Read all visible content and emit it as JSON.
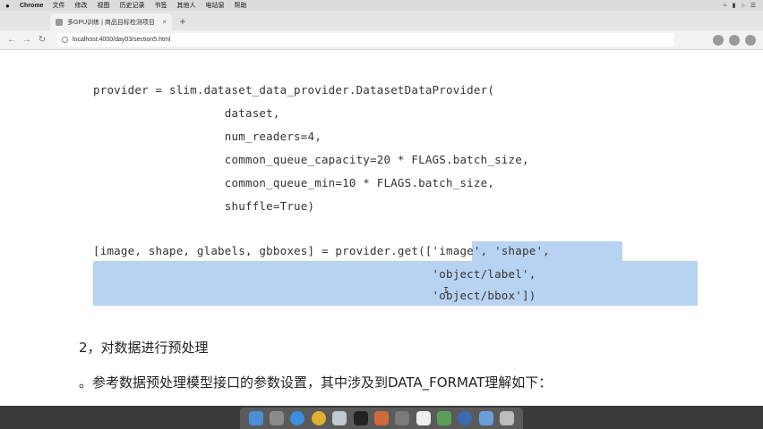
{
  "menubar": {
    "app_name": "Chrome",
    "items": [
      "文件",
      "修改",
      "视图",
      "历史记录",
      "书签",
      "其他人",
      "电站窗",
      "帮助"
    ]
  },
  "browser": {
    "tab_title": "多GPU训练 | 商品目标检测项目",
    "new_tab": "+",
    "url": "localhost:4000/day03/section5.html"
  },
  "code": {
    "lines": [
      "provider = slim.dataset_data_provider.DatasetDataProvider(",
      "                   dataset,",
      "                   num_readers=4,",
      "                   common_queue_capacity=20 * FLAGS.batch_size,",
      "                   common_queue_min=10 * FLAGS.batch_size,",
      "                   shuffle=True)",
      "",
      "[image, shape, glabels, gbboxes] = provider.get(['image', 'shape',",
      "                                                 'object/label',",
      "                                                 'object/bbox'])"
    ]
  },
  "section": {
    "heading": "2，对数据进行预处理",
    "paragraph": "。参考数据预处理模型接口的参数设置，其中涉及到DATA_FORMAT理解如下："
  },
  "cursor_glyph": "I"
}
